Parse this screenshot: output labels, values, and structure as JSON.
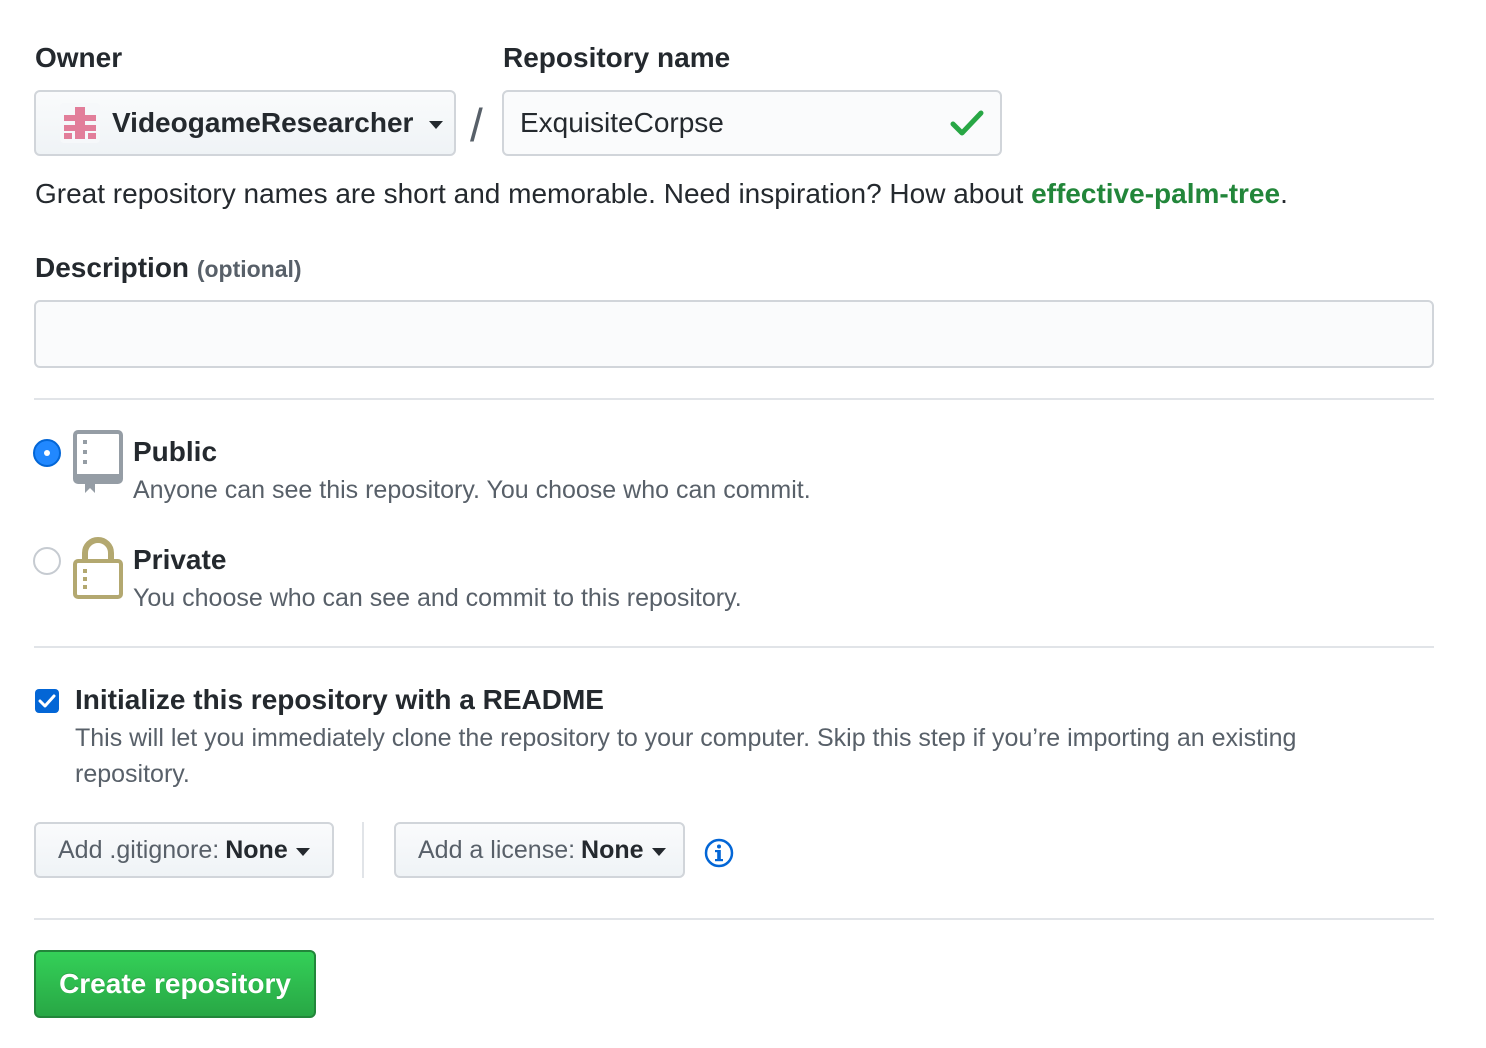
{
  "owner": {
    "label": "Owner",
    "selected": "VideogameResearcher"
  },
  "repository": {
    "label": "Repository name",
    "separator": "/",
    "value": "ExquisiteCorpse",
    "hint_prefix": "Great repository names are short and memorable. Need inspiration? How about ",
    "suggestion": "effective-palm-tree",
    "hint_suffix": "."
  },
  "description": {
    "label": "Description",
    "optional": "(optional)",
    "value": ""
  },
  "visibility": {
    "public": {
      "title": "Public",
      "desc": "Anyone can see this repository. You choose who can commit.",
      "checked": true
    },
    "private": {
      "title": "Private",
      "desc": "You choose who can see and commit to this repository.",
      "checked": false
    }
  },
  "readme": {
    "checked": true,
    "title": "Initialize this repository with a README",
    "desc": "This will let you immediately clone the repository to your computer. Skip this step if you’re importing an existing repository."
  },
  "gitignore": {
    "prefix": "Add .gitignore:",
    "value": "None"
  },
  "license": {
    "prefix": "Add a license:",
    "value": "None"
  },
  "submit": {
    "label": "Create repository"
  },
  "colors": {
    "accent_blue": "#0366d6",
    "success_green": "#28a745",
    "suggestion_green": "#22863a",
    "lock_gold": "#b3a870"
  }
}
